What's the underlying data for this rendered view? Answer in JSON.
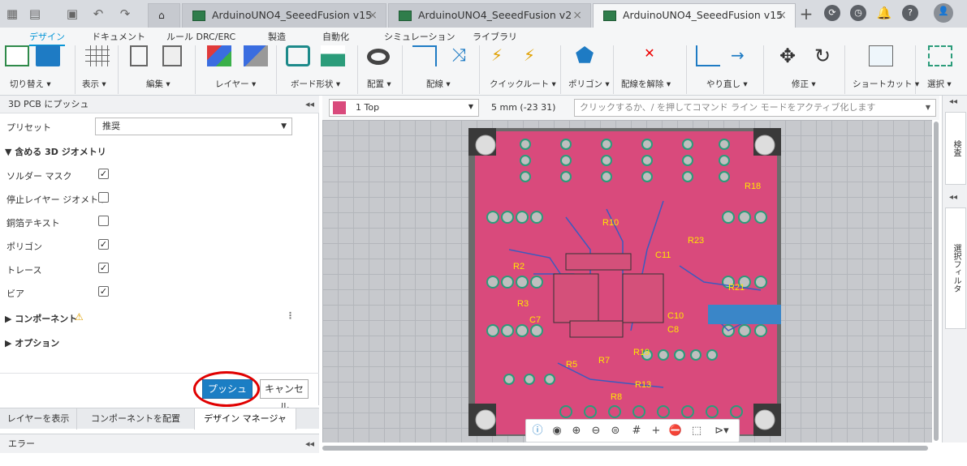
{
  "titlebar": {
    "tabs": [
      {
        "label": "ArduinoUNO4_SeeedFusion v15",
        "close": "×"
      },
      {
        "label": "ArduinoUNO4_SeeedFusion v2",
        "close": "×"
      },
      {
        "label": "ArduinoUNO4_SeeedFusion v15",
        "close": "×"
      }
    ],
    "new_tab": "+"
  },
  "ribbon": {
    "tabs": [
      "デザイン",
      "ドキュメント",
      "ルール DRC/ERC",
      "製造",
      "自動化",
      "シミュレーション",
      "ライブラリ"
    ],
    "groups": [
      "切り替え ▾",
      "表示 ▾",
      "編集 ▾",
      "レイヤー ▾",
      "ボード形状 ▾",
      "配置 ▾",
      "配線 ▾",
      "クイックルート ▾",
      "ポリゴン ▾",
      "配線を解除 ▾",
      "やり直し ▾",
      "修正 ▾",
      "ショートカット ▾",
      "選択 ▾"
    ]
  },
  "panel": {
    "title": "3D PCB にプッシュ",
    "collapse": "◂◂",
    "preset_label": "プリセット",
    "preset_value": "推奨",
    "section_geometry": "▼ 含める 3D ジオメトリ",
    "options": [
      {
        "label": "ソルダー マスク",
        "checked": true
      },
      {
        "label": "停止レイヤー ジオメトリ",
        "checked": false
      },
      {
        "label": "銅箔テキスト",
        "checked": false
      },
      {
        "label": "ポリゴン",
        "checked": true
      },
      {
        "label": "トレース",
        "checked": true
      },
      {
        "label": "ビア",
        "checked": true
      }
    ],
    "section_components": "▶ コンポーネント",
    "section_options": "▶ オプション",
    "push_button": "プッシュ",
    "cancel_button": "キャンセル"
  },
  "bottom_tabs": [
    "レイヤーを表示",
    "コンポーネントを配置",
    "デザイン マネージャ"
  ],
  "errors_label": "エラー",
  "canvas_toolbar": {
    "layer": "1 Top",
    "grid": "5 mm (-23 31)",
    "command_placeholder": "クリックするか、/ を押してコマンド ライン モードをアクティブ化します"
  },
  "right_tabs": [
    "検査",
    "選択フィルタ"
  ],
  "pcb_labels": [
    "R18",
    "R23",
    "R21",
    "R10",
    "C11",
    "C10",
    "C8",
    "R2",
    "R3",
    "C7",
    "R19",
    "R13",
    "R7",
    "R8",
    "R5"
  ],
  "colors": {
    "board": "#d94a7c",
    "accent": "#0696d7",
    "highlight": "#e00000"
  }
}
